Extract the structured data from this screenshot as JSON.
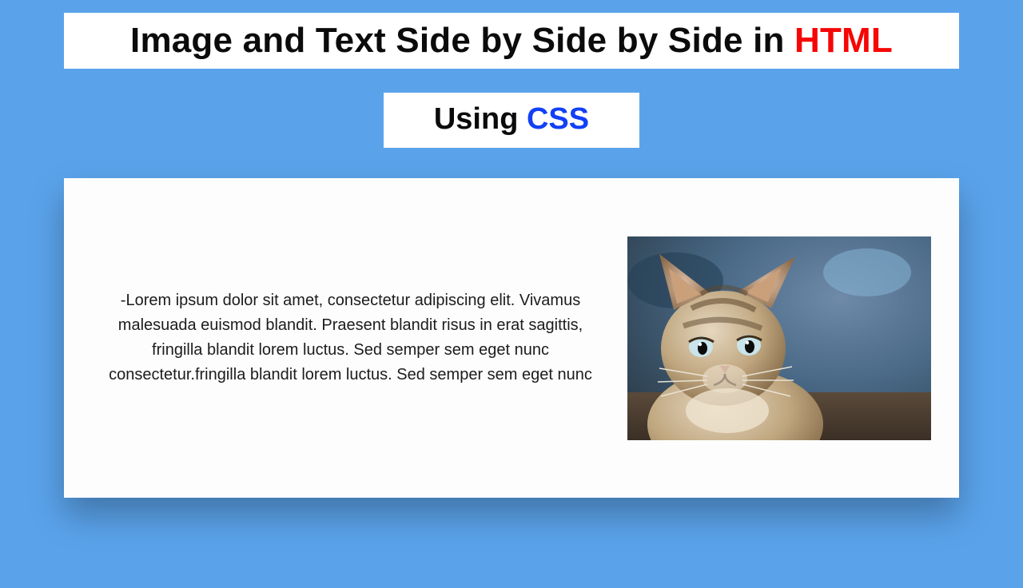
{
  "title": {
    "plain": "Image and Text Side by Side by Side in ",
    "accent": "HTML"
  },
  "subtitle": {
    "plain": "Using ",
    "accent": "CSS"
  },
  "card": {
    "paragraph": "-Lorem ipsum dolor sit amet, consectetur adipiscing elit. Vivamus malesuada euismod blandit. Praesent blandit risus in erat sagittis, fringilla blandit lorem luctus. Sed semper sem eget nunc consectetur.fringilla blandit lorem luctus. Sed semper sem eget nunc",
    "image_alt": "kitten-photo"
  }
}
